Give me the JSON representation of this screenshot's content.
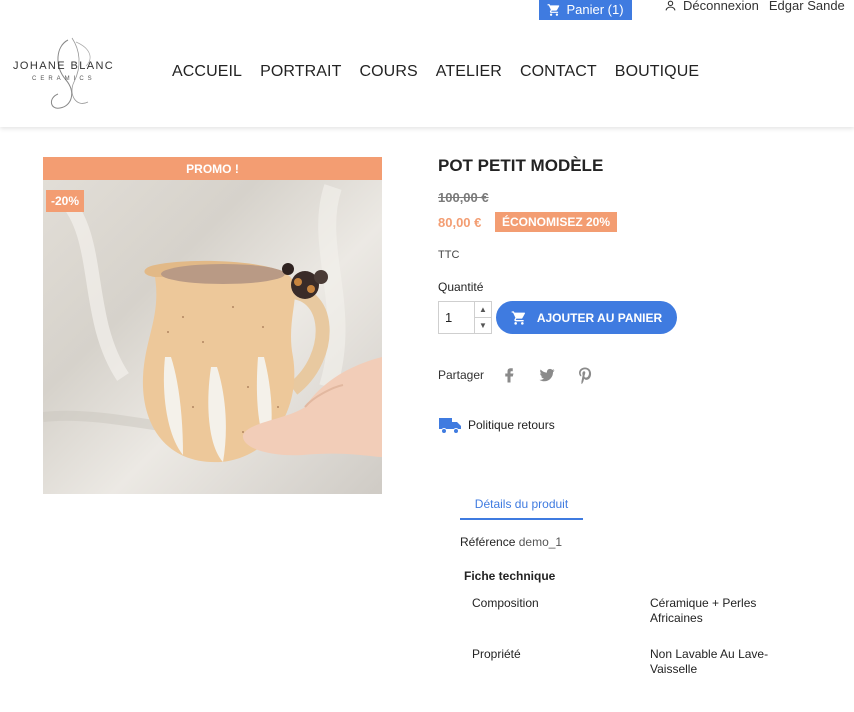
{
  "header": {
    "cart_label": "Panier (1)",
    "logout_label": "Déconnexion",
    "user_name": "Edgar Sande",
    "logo_text": "JOHANE BLANC",
    "logo_sub": "CERAMICS",
    "nav": [
      "ACCUEIL",
      "PORTRAIT",
      "COURS",
      "ATELIER",
      "CONTACT",
      "BOUTIQUE"
    ]
  },
  "product": {
    "promo_flag": "PROMO !",
    "discount_flag": "-20%",
    "title": "POT PETIT MODÈLE",
    "old_price": "100,00 €",
    "new_price": "80,00 €",
    "save_badge": "ÉCONOMISEZ 20%",
    "tax_label": "TTC",
    "quantity_label": "Quantité",
    "quantity_value": "1",
    "add_to_cart": "AJOUTER AU PANIER",
    "share_label": "Partager",
    "returns_label": "Politique retours",
    "tab_details": "Détails du produit",
    "reference_label": "Référence",
    "reference_value": "demo_1",
    "features_title": "Fiche technique",
    "features": [
      {
        "name": "Composition",
        "value": "Céramique + Perles Africaines"
      },
      {
        "name": "Propriété",
        "value": "Non Lavable Au Lave-Vaisselle"
      }
    ]
  },
  "colors": {
    "accent_blue": "#3f7be0",
    "promo_orange": "#f39d72"
  }
}
